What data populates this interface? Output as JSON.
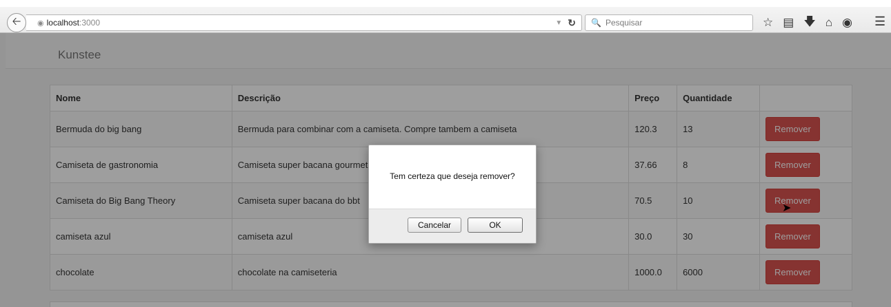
{
  "browser": {
    "url_host": "localhost",
    "url_port": ":3000",
    "search_placeholder": "Pesquisar"
  },
  "app": {
    "brand": "Kunstee"
  },
  "table": {
    "headers": {
      "nome": "Nome",
      "descricao": "Descrição",
      "preco": "Preço",
      "quantidade": "Quantidade"
    },
    "rows": [
      {
        "nome": "Bermuda do big bang",
        "descricao": "Bermuda para combinar com a camiseta. Compre tambem a camiseta",
        "preco": "120.3",
        "quantidade": "13"
      },
      {
        "nome": "Camiseta de gastronomia",
        "descricao": "Camiseta super bacana gourmet",
        "preco": "37.66",
        "quantidade": "8"
      },
      {
        "nome": "Camiseta do Big Bang Theory",
        "descricao": "Camiseta super bacana do bbt",
        "preco": "70.5",
        "quantidade": "10"
      },
      {
        "nome": "camiseta azul",
        "descricao": "camiseta azul",
        "preco": "30.0",
        "quantidade": "30"
      },
      {
        "nome": "chocolate",
        "descricao": "chocolate na camiseteria",
        "preco": "1000.0",
        "quantidade": "6000"
      }
    ],
    "remove_label": "Remover"
  },
  "dialog": {
    "message": "Tem certeza que deseja remover?",
    "cancel_label": "Cancelar",
    "ok_label": "OK"
  },
  "colors": {
    "danger": "#d9534f",
    "page_bg": "#f1f1f1"
  }
}
